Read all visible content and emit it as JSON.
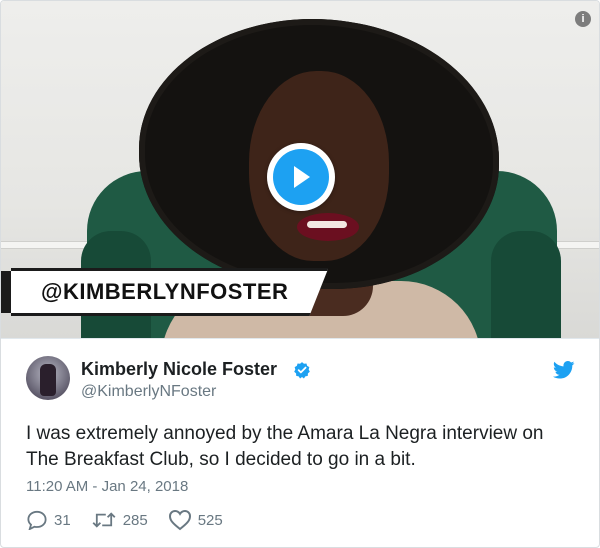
{
  "video": {
    "overlay_handle": "@KIMBERLYNFOSTER",
    "play_icon": "play-icon",
    "info_icon": "info-icon",
    "info_glyph": "i"
  },
  "tweet": {
    "author_name": "Kimberly Nicole Foster",
    "author_handle": "@KimberlyNFoster",
    "verified_icon": "verified-badge-icon",
    "text": "I was extremely annoyed by the Amara La Negra interview on The Breakfast Club, so I decided to go in a bit.",
    "timestamp": "11:20 AM - Jan 24, 2018",
    "brand_icon": "twitter-bird-icon",
    "actions": {
      "replies": "31",
      "retweets": "285",
      "likes": "525"
    }
  },
  "colors": {
    "accent": "#1da1f2",
    "secondary_text": "#697882",
    "primary_text": "#1c2022"
  }
}
